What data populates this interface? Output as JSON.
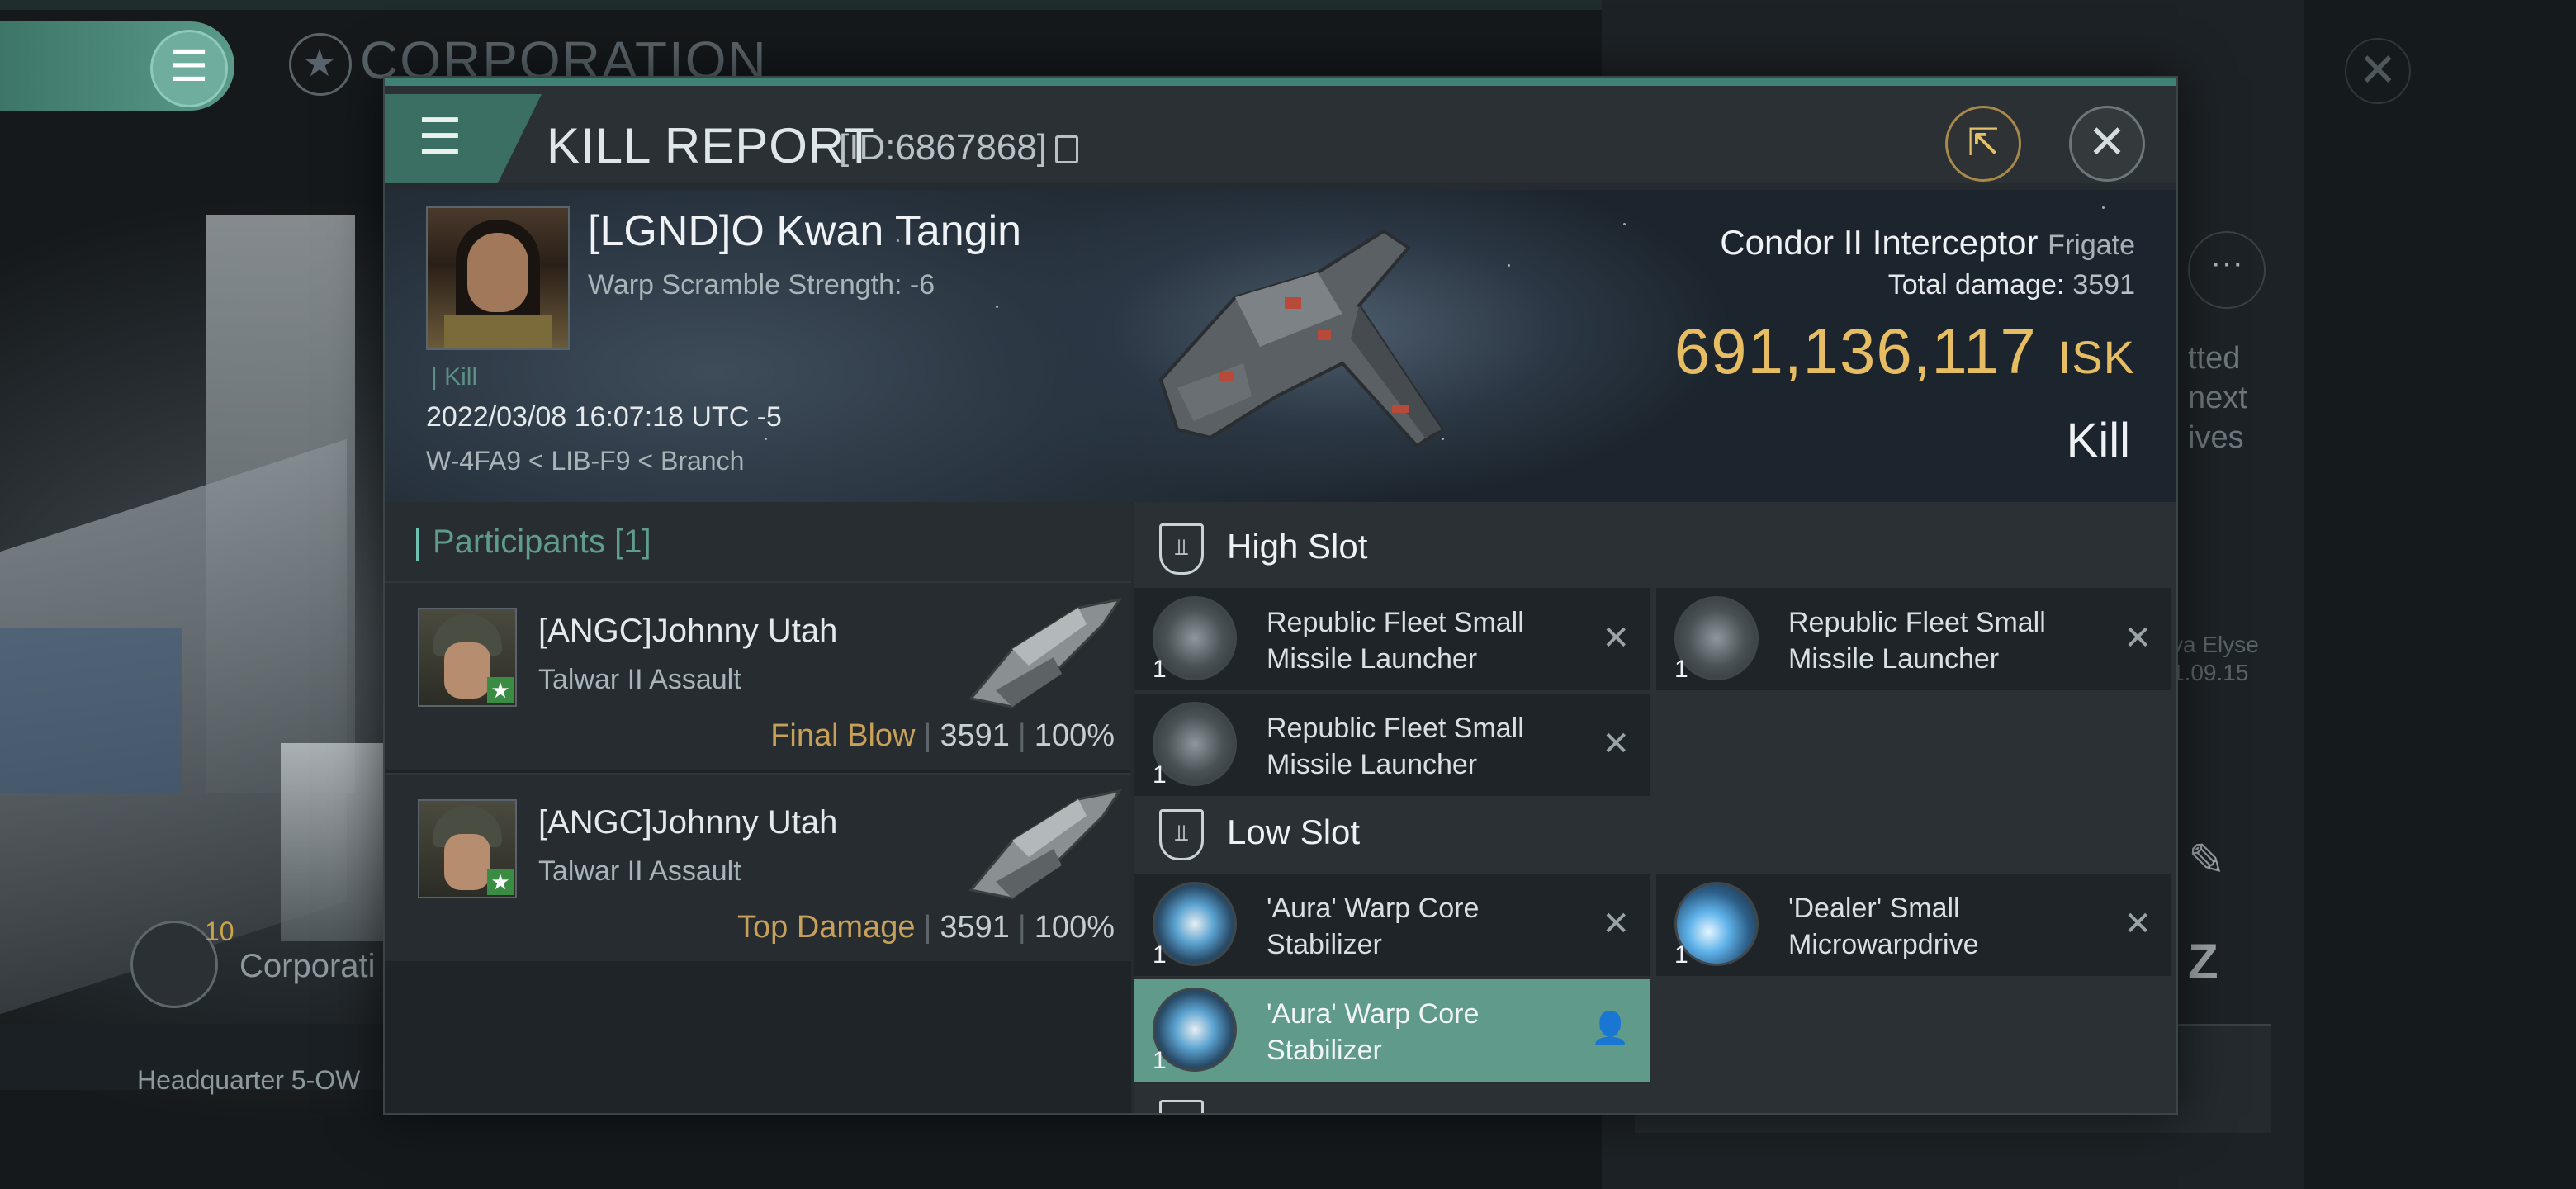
{
  "background": {
    "corp_title": "CORPORATION",
    "corp_count": "10",
    "corp_label": "Corporati",
    "hq_label": "Headquarter 5-OW",
    "right_text": [
      "tted",
      "next",
      "ives"
    ],
    "right_small": [
      "va Elyse",
      "1.09.15"
    ]
  },
  "modal": {
    "title": "KILL REPORT",
    "report_id": "[ID:6867868]"
  },
  "victim": {
    "name": "[LGND]O Kwan Tangin",
    "warp_scramble": "Warp Scramble Strength: -6",
    "kill_tag": "| Kill",
    "timestamp": "2022/03/08 16:07:18 UTC -5",
    "location": "W-4FA9 < LIB-F9 < Branch",
    "ship_name": "Condor II Interceptor",
    "ship_class": "Frigate",
    "total_damage_label": "Total damage:",
    "total_damage_value": "3591",
    "isk_value": "691,136,117",
    "isk_unit": "ISK",
    "result": "Kill"
  },
  "participants": {
    "header": "Participants [1]",
    "rows": [
      {
        "name": "[ANGC]Johnny Utah",
        "ship": "Talwar II Assault",
        "tag": "Final Blow",
        "damage": "3591",
        "percent": "100%"
      },
      {
        "name": "[ANGC]Johnny Utah",
        "ship": "Talwar II Assault",
        "tag": "Top Damage",
        "damage": "3591",
        "percent": "100%"
      }
    ]
  },
  "fittings": {
    "high_slot": {
      "title": "High Slot",
      "items": [
        {
          "name": "Republic Fleet Small Missile Launcher",
          "qty": "1",
          "status": "destroyed"
        },
        {
          "name": "Republic Fleet Small Missile Launcher",
          "qty": "1",
          "status": "destroyed"
        },
        {
          "name": "Republic Fleet Small Missile Launcher",
          "qty": "1",
          "status": "destroyed"
        }
      ]
    },
    "low_slot": {
      "title": "Low Slot",
      "items": [
        {
          "name": "'Aura' Warp Core Stabilizer",
          "qty": "1",
          "status": "destroyed"
        },
        {
          "name": "'Dealer' Small Microwarpdrive",
          "qty": "1",
          "status": "destroyed"
        },
        {
          "name": "'Aura' Warp Core Stabilizer",
          "qty": "1",
          "status": "dropped"
        }
      ]
    }
  },
  "colors": {
    "accent": "#3f8174",
    "isk": "#e6bd63",
    "tag": "#c7a15a",
    "active_item": "#5f9a8b"
  }
}
